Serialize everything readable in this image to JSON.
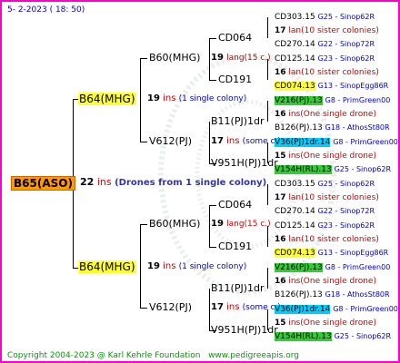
{
  "header": {
    "date": "5-  2-2023 ( 18: 50)"
  },
  "labels": {
    "ins": "ins"
  },
  "root": {
    "name": "B65(ASO)",
    "count": "22",
    "note": "(Drones from 1 single colony)"
  },
  "gen1": [
    {
      "name": "B64(MHG)",
      "count": "19",
      "note": "(1 single colony)"
    },
    {
      "name": "B64(MHG)",
      "count": "19",
      "note": "(1 single colony)"
    }
  ],
  "gen2": [
    {
      "name": "B60(MHG)",
      "count": "19",
      "suffix": "lang(15 c.)"
    },
    {
      "name": "V612(PJ)",
      "count": "17",
      "note": "(some c.)"
    },
    {
      "name": "B60(MHG)",
      "count": "19",
      "suffix": "lang(15 c.)"
    },
    {
      "name": "V612(PJ)",
      "count": "17",
      "note": "(some c.)"
    }
  ],
  "gen3": [
    {
      "name": "CD064",
      "count": "17",
      "note": "lan(10 sister colonies)"
    },
    {
      "name": "CD191",
      "count": "16",
      "note": "lan(10 sister colonies)"
    },
    {
      "name": "B11(PJ)1dr",
      "count": "16",
      "note": "ins(One single drone)"
    },
    {
      "name": "V951H(PJ)1dr",
      "count": "15",
      "note": "ins(One single drone)"
    },
    {
      "name": "CD064",
      "count": "17",
      "note": "lan(10 sister colonies)"
    },
    {
      "name": "CD191",
      "count": "16",
      "note": "lan(10 sister colonies)"
    },
    {
      "name": "B11(PJ)1dr",
      "count": "16",
      "note": "ins(One single drone)"
    },
    {
      "name": "V951H(PJ)1dr",
      "count": "15",
      "note": "ins(One single drone)"
    }
  ],
  "gen4": [
    {
      "name": "CD303.15",
      "breeder": "G25 - Sinop62R"
    },
    {
      "name": "CD270.14",
      "breeder": "G22 - Sinop72R"
    },
    {
      "name": "CD125.14",
      "breeder": "G23 - Sinop62R"
    },
    {
      "name": "CD074.13",
      "breeder": "G13 - SinopEgg86R"
    },
    {
      "name": "V216(PJ).13",
      "breeder": "G8 - PrimGreen00"
    },
    {
      "name": "B126(PJ).13",
      "breeder": "G18 - AthosSt80R"
    },
    {
      "name": "V36(PJ)1dr.14",
      "breeder": "G8 - PrimGreen00"
    },
    {
      "name": "V154H(RL).13",
      "breeder": "G25 - Sinop62R"
    },
    {
      "name": "CD303.15",
      "breeder": "G25 - Sinop62R"
    },
    {
      "name": "CD270.14",
      "breeder": "G22 - Sinop72R"
    },
    {
      "name": "CD125.14",
      "breeder": "G23 - Sinop62R"
    },
    {
      "name": "CD074.13",
      "breeder": "G13 - SinopEgg86R"
    },
    {
      "name": "V216(PJ).13",
      "breeder": "G8 - PrimGreen00"
    },
    {
      "name": "B126(PJ).13",
      "breeder": "G18 - AthosSt80R"
    },
    {
      "name": "V36(PJ)1dr.14",
      "breeder": "G8 - PrimGreen00"
    },
    {
      "name": "V154H(RL).13",
      "breeder": "G25 - Sinop62R"
    }
  ],
  "footer": {
    "copyright": "Copyright 2004-2023 @ Karl Kehrle Foundation",
    "url": "www.pedigreeapis.org"
  },
  "colors": {
    "frame": "#ff00cc",
    "root_highlight": "#ff9900",
    "parent_highlight": "#ffff33",
    "green_highlight": "#33cc33",
    "cyan_highlight": "#00ccff"
  }
}
